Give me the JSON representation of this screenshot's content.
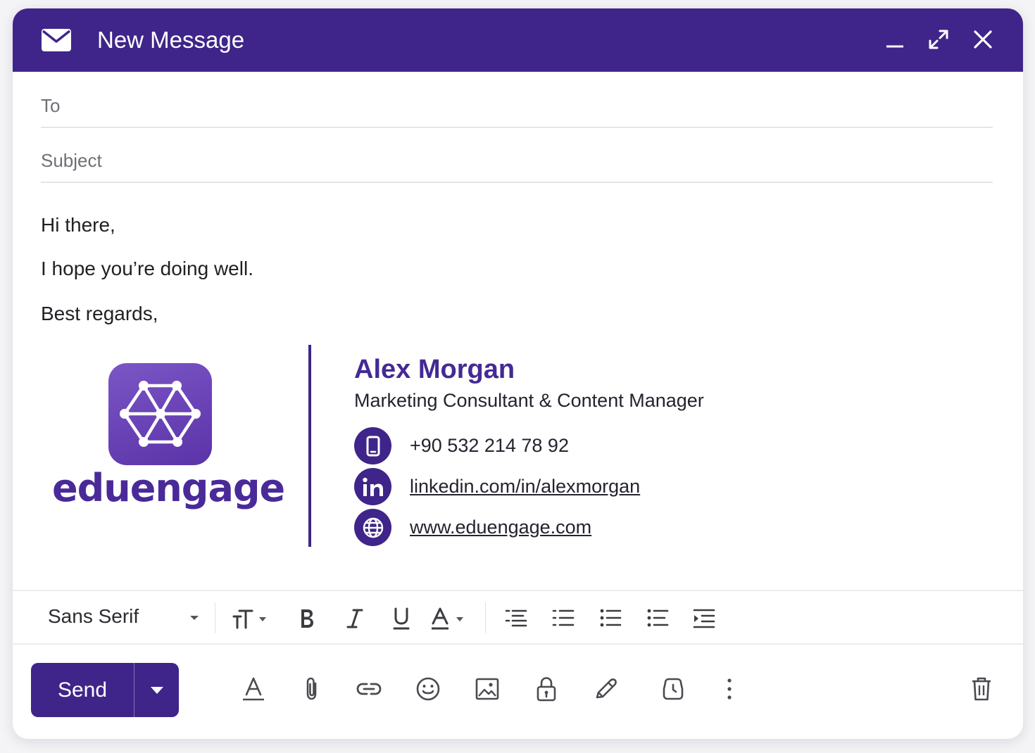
{
  "window": {
    "title": "New Message"
  },
  "compose": {
    "to_placeholder": "To",
    "subject_placeholder": "Subject",
    "body_lines": [
      "Hi there,",
      "I hope you’re doing well.",
      "Best regards,"
    ]
  },
  "signature": {
    "logo_text": "eduengage",
    "name": "Alex Morgan",
    "role": "Marketing Consultant & Content Manager",
    "phone": "+90 532 214 78 92",
    "linkedin": "linkedin.com/in/alexmorgan",
    "website": "www.eduengage.com"
  },
  "format_bar": {
    "font": "Sans Serif",
    "icons": [
      "font-size-icon",
      "bold-icon",
      "italic-icon",
      "underline-icon",
      "text-color-icon",
      "align-icon",
      "numbered-list-icon",
      "bulleted-list-icon",
      "indent-less-icon",
      "indent-more-icon"
    ]
  },
  "actions": {
    "send_label": "Send",
    "icons": [
      "formatting-icon",
      "attach-icon",
      "link-icon",
      "emoji-icon",
      "image-icon",
      "lock-icon",
      "signature-pen-icon",
      "schedule-icon",
      "more-options-icon",
      "trash-icon"
    ]
  },
  "colors": {
    "brand": "#3f2589",
    "brand_light": "#7b56c6",
    "text": "#202124",
    "placeholder": "#6f6f76"
  }
}
